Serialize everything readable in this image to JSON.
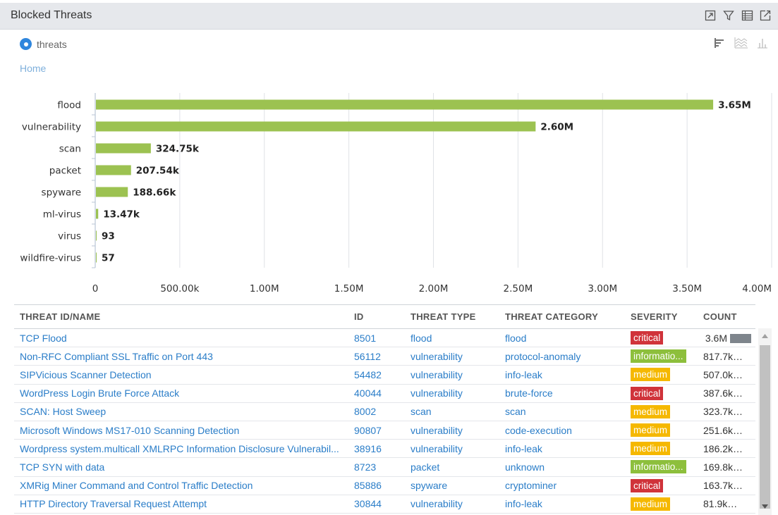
{
  "panel": {
    "title": "Blocked Threats",
    "legend_label": "threats",
    "breadcrumb": "Home",
    "accent": "#2f86dd",
    "bar_color": "#9cc251"
  },
  "chart_data": {
    "type": "bar",
    "orientation": "horizontal",
    "categories": [
      "flood",
      "vulnerability",
      "scan",
      "packet",
      "spyware",
      "ml-virus",
      "virus",
      "wildfire-virus"
    ],
    "values": [
      3650000,
      2600000,
      324750,
      207540,
      188660,
      13470,
      93,
      57
    ],
    "value_labels": [
      "3.65M",
      "2.60M",
      "324.75k",
      "207.54k",
      "188.66k",
      "13.47k",
      "93",
      "57"
    ],
    "xlim": [
      0,
      4000000
    ],
    "ticks": [
      0,
      500000,
      1000000,
      1500000,
      2000000,
      2500000,
      3000000,
      3500000,
      4000000
    ],
    "tick_labels": [
      "0",
      "500.00k",
      "1.00M",
      "1.50M",
      "2.00M",
      "2.50M",
      "3.00M",
      "3.50M",
      "4.00M"
    ],
    "grid": true
  },
  "table": {
    "headers": [
      "THREAT ID/NAME",
      "ID",
      "THREAT TYPE",
      "THREAT CATEGORY",
      "SEVERITY",
      "COUNT"
    ],
    "severity_colors": {
      "critical": "#d0333a",
      "informational": "#8dbf3c",
      "medium": "#f5b800"
    },
    "rows": [
      {
        "name": "TCP Flood",
        "id": "8501",
        "type": "flood",
        "category": "flood",
        "severity": "critical",
        "severity_label": "critical",
        "count": "3.6M",
        "count_value": 3600000
      },
      {
        "name": "Non-RFC Compliant SSL Traffic on Port 443",
        "id": "56112",
        "type": "vulnerability",
        "category": "protocol-anomaly",
        "severity": "informational",
        "severity_label": "informatio...",
        "count": "817.7k",
        "count_value": 817700
      },
      {
        "name": "SIPVicious Scanner Detection",
        "id": "54482",
        "type": "vulnerability",
        "category": "info-leak",
        "severity": "medium",
        "severity_label": "medium",
        "count": "507.0k",
        "count_value": 507000
      },
      {
        "name": "WordPress Login Brute Force Attack",
        "id": "40044",
        "type": "vulnerability",
        "category": "brute-force",
        "severity": "critical",
        "severity_label": "critical",
        "count": "387.6k",
        "count_value": 387600
      },
      {
        "name": "SCAN: Host Sweep",
        "id": "8002",
        "type": "scan",
        "category": "scan",
        "severity": "medium",
        "severity_label": "medium",
        "count": "323.7k",
        "count_value": 323700
      },
      {
        "name": "Microsoft Windows MS17-010 Scanning Detection",
        "id": "90807",
        "type": "vulnerability",
        "category": "code-execution",
        "severity": "medium",
        "severity_label": "medium",
        "count": "251.6k",
        "count_value": 251600
      },
      {
        "name": "Wordpress system.multicall XMLRPC Information Disclosure Vulnerabil...",
        "id": "38916",
        "type": "vulnerability",
        "category": "info-leak",
        "severity": "medium",
        "severity_label": "medium",
        "count": "186.2k",
        "count_value": 186200
      },
      {
        "name": "TCP SYN with data",
        "id": "8723",
        "type": "packet",
        "category": "unknown",
        "severity": "informational",
        "severity_label": "informatio...",
        "count": "169.8k",
        "count_value": 169800
      },
      {
        "name": "XMRig Miner Command and Control Traffic Detection",
        "id": "85886",
        "type": "spyware",
        "category": "cryptominer",
        "severity": "critical",
        "severity_label": "critical",
        "count": "163.7k",
        "count_value": 163700
      },
      {
        "name": "HTTP Directory Traversal Request Attempt",
        "id": "30844",
        "type": "vulnerability",
        "category": "info-leak",
        "severity": "medium",
        "severity_label": "medium",
        "count": "81.9k",
        "count_value": 81900
      }
    ]
  },
  "icons": {
    "title_tools": [
      "expand-icon",
      "filter-icon",
      "table-view-icon",
      "export-icon"
    ],
    "view_tools": [
      "bar-chart-horizontal-icon",
      "area-chart-icon",
      "column-chart-icon"
    ]
  }
}
